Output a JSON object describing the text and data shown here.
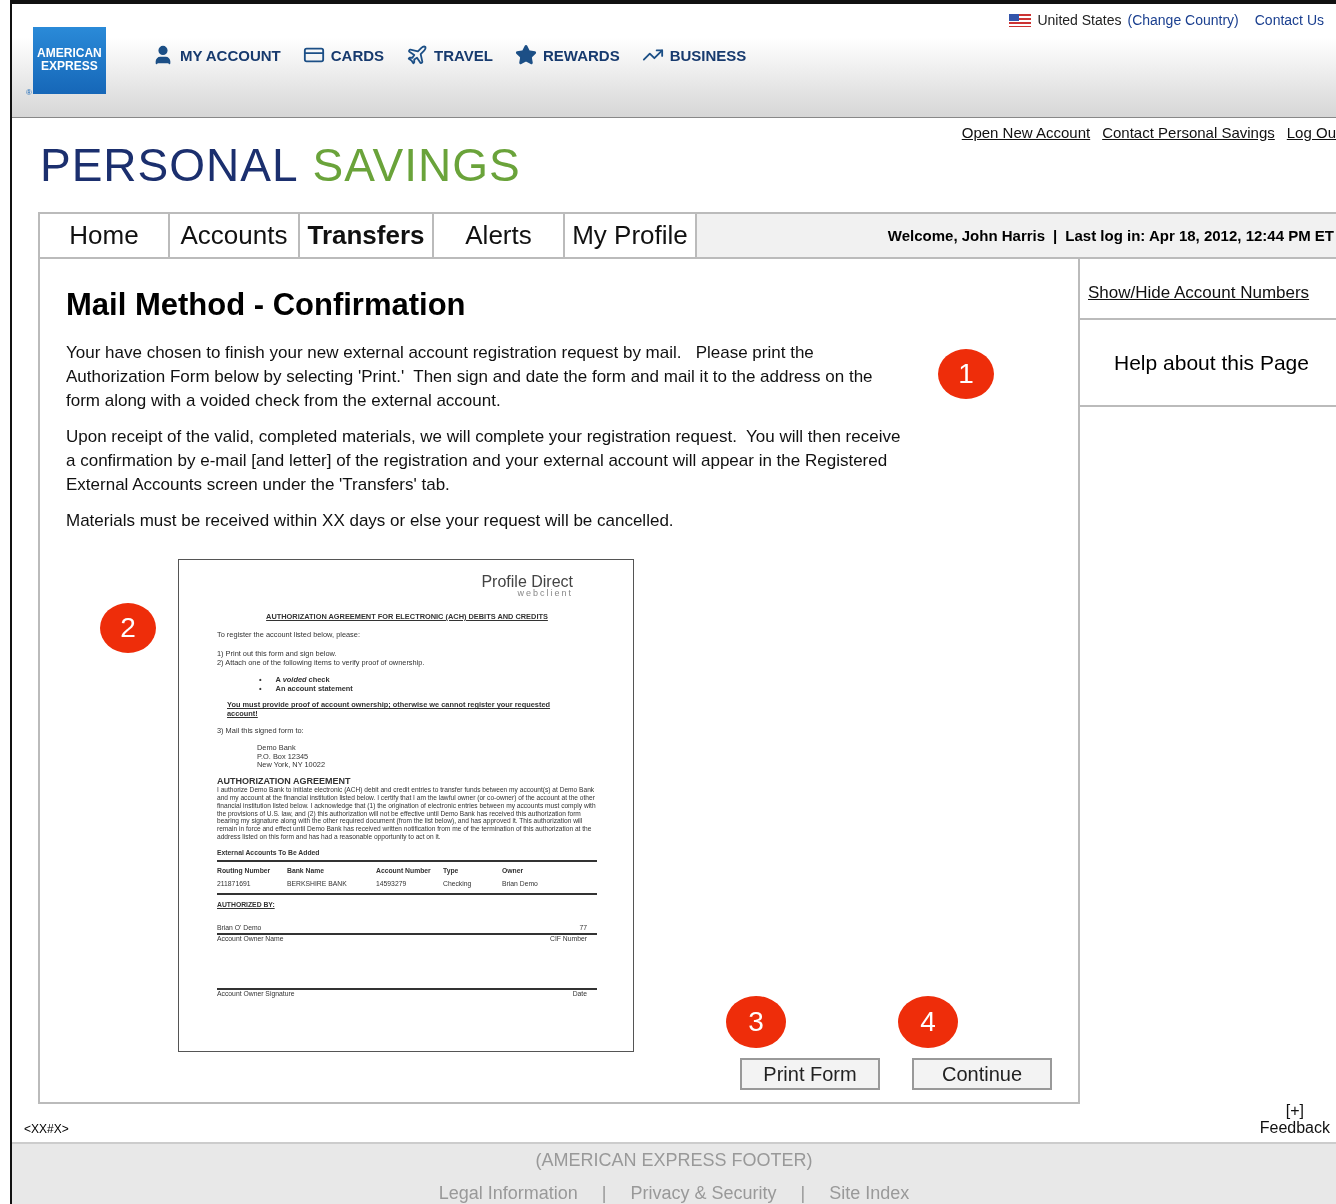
{
  "top_links": {
    "country": "United States",
    "change": "(Change Country)",
    "contact": "Contact Us"
  },
  "logo": [
    "AMERICAN",
    "EXPRESS"
  ],
  "logo_mark": "®",
  "nav": [
    {
      "label": "MY ACCOUNT",
      "kind": "user"
    },
    {
      "label": "CARDS",
      "kind": "cards"
    },
    {
      "label": "TRAVEL",
      "kind": "plane"
    },
    {
      "label": "REWARDS",
      "kind": "star"
    },
    {
      "label": "BUSINESS",
      "kind": "chart"
    }
  ],
  "site_links": [
    "Open New Account",
    "Contact Personal Savings",
    "Log Ou"
  ],
  "brand": {
    "first": "PERSONAL",
    "second": "SAVINGS"
  },
  "tabs": [
    {
      "label": "Home",
      "selected": false
    },
    {
      "label": "Accounts",
      "selected": false
    },
    {
      "label": "Transfers",
      "selected": true
    },
    {
      "label": "Alerts",
      "selected": false
    },
    {
      "label": "My Profile",
      "selected": false
    }
  ],
  "welcome": {
    "name": "Welcome, John Harris",
    "separator": "|",
    "last_login": "Last log in: Apr 18, 2012, 12:44 PM ET"
  },
  "heading": "Mail Method - Confirmation",
  "paragraphs": [
    "Your have chosen to finish your new external account registration request by mail.   Please print the Authorization Form below by selecting 'Print.'  Then sign and date the form and mail it to the address on the form along with a voided check from the external account.",
    "Upon receipt of the valid, completed materials, we will complete your registration request.  You will then receive a confirmation by e-mail [and letter] of the registration and your external account will appear in the Registered External Accounts screen under the 'Transfers' tab.",
    "Materials must be received within XX days or else your request will be cancelled."
  ],
  "document": {
    "logo": "Profile Direct",
    "logo_sub": "webclient",
    "title": "AUTHORIZATION AGREEMENT FOR ELECTRONIC (ACH) DEBITS AND CREDITS",
    "intro": "To register the account listed below, please:",
    "steps": [
      "1) Print out this form and sign below.",
      "2) Attach one of the following items to verify proof of ownership."
    ],
    "bullet": "•",
    "bullets": [
      "A *voided* check",
      "An account statement"
    ],
    "warning": "You must provide proof of account ownership; otherwise we cannot register your requested account!",
    "mail_step": "3) Mail this signed form to:",
    "address": [
      "Demo Bank",
      "P.O. Box 12345",
      "New York, NY 10022"
    ],
    "agreement_title": "AUTHORIZATION AGREEMENT",
    "agreement": "I authorize Demo Bank to initiate electronic (ACH) debit and credit entries to transfer funds between my account(s) at Demo Bank and my account at the financial institution listed below. I certify that I am the lawful owner (or co-owner) of the account at the other financial institution listed below. I acknowledge that (1) the origination of electronic entries between my accounts must comply with the provisions of U.S. law, and (2) this authorization will not be effective until Demo Bank has received this authorization form bearing my signature along with the other required document (from the list below), and has approved it. This authorization will remain in force and effect until Demo Bank has received written notification from me of the termination of this authorization at the address listed on this form and has had a reasonable opportunity to act on it.",
    "table_title": "External Accounts To Be Added",
    "columns": [
      "Routing Number",
      "Bank Name",
      "Account Number",
      "Type",
      "Owner"
    ],
    "row": [
      "211871691",
      "BERKSHIRE BANK",
      "14593279",
      "Checking",
      "Brian Demo"
    ],
    "authorized_by": "AUTHORIZED BY:",
    "owner_name": "Brian O' Demo",
    "cif": "77",
    "owner_label": "Account Owner Name",
    "cif_label": "CIF Number",
    "signature_label": "Account Owner Signature",
    "date_label": "Date"
  },
  "buttons": [
    {
      "label": "Print Form",
      "badge": "3"
    },
    {
      "label": "Continue",
      "badge": "4"
    }
  ],
  "badges": [
    "1",
    "2"
  ],
  "sidebar": {
    "toggle": "Show/Hide Account Numbers",
    "help": "Help about this Page"
  },
  "page_code": "<XX#X>",
  "feedback": {
    "icon": "[+]",
    "label": "Feedback"
  },
  "footer": {
    "title": "(AMERICAN EXPRESS FOOTER)",
    "links": [
      "Legal Information",
      "Privacy & Security",
      "Site Index"
    ],
    "separator": "|"
  }
}
